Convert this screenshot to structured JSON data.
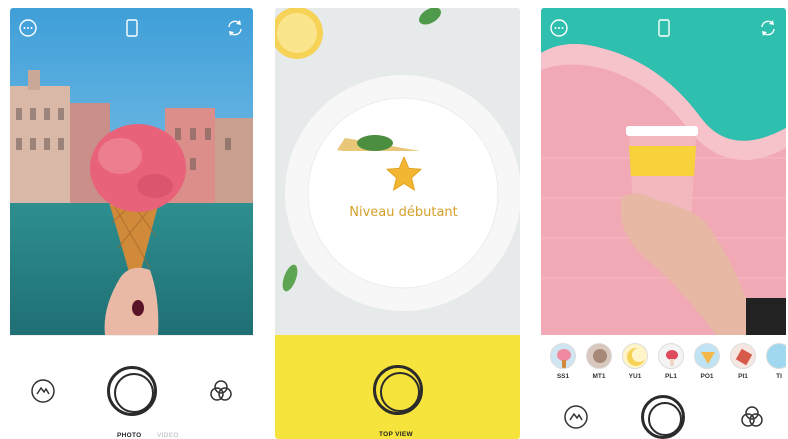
{
  "screens": [
    {
      "topbar_icons": [
        "more-icon",
        "aspect-ratio-icon",
        "switch-camera-icon"
      ],
      "modes": [
        {
          "label": "PHOTO",
          "active": true
        },
        {
          "label": "VIDEO",
          "active": false
        }
      ],
      "left_icon": "tools-icon",
      "right_icon": "filters-icon"
    },
    {
      "topbar_icons": [],
      "badge": {
        "icon": "star-icon",
        "label": "Niveau débutant"
      },
      "mode": "TOP VIEW",
      "accent": "#f6e43c"
    },
    {
      "topbar_icons": [
        "more-icon",
        "aspect-ratio-icon",
        "switch-camera-icon"
      ],
      "filters": [
        {
          "label": "SS1"
        },
        {
          "label": "MT1"
        },
        {
          "label": "YU1"
        },
        {
          "label": "PL1"
        },
        {
          "label": "PO1"
        },
        {
          "label": "PI1"
        },
        {
          "label": "TI"
        }
      ],
      "left_icon": "tools-icon",
      "right_icon": "filters-icon"
    }
  ],
  "colors": {
    "yellow": "#f6e43c",
    "star": "#f2b632",
    "badge_text": "#d4a02a"
  }
}
